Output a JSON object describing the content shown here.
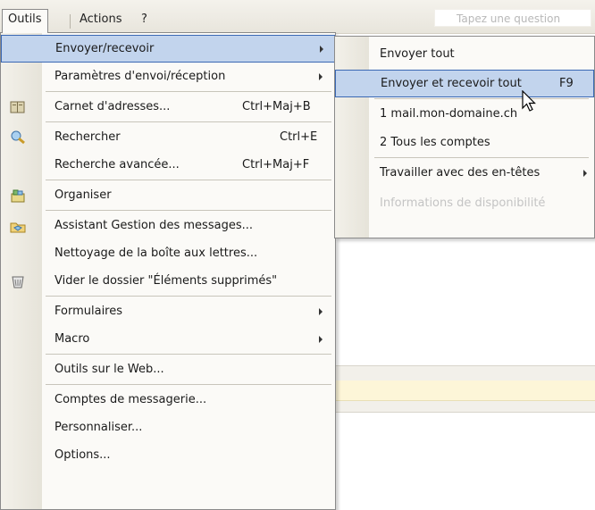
{
  "menubar": {
    "items": [
      {
        "label": "Outils"
      },
      {
        "label": "Actions"
      },
      {
        "label": "?"
      }
    ],
    "ask_placeholder": "Tapez une question"
  },
  "tools_menu": {
    "items": [
      {
        "label": "Envoyer/recevoir",
        "submenu": true
      },
      {
        "label": "Paramètres d'envoi/réception",
        "submenu": true
      },
      {
        "label": "Carnet d'adresses...",
        "shortcut": "Ctrl+Maj+B",
        "icon": "address-book-icon"
      },
      {
        "label": "Rechercher",
        "shortcut": "Ctrl+E",
        "icon": "search-icon"
      },
      {
        "label": "Recherche avancée...",
        "shortcut": "Ctrl+Maj+F"
      },
      {
        "label": "Organiser",
        "icon": "organize-icon"
      },
      {
        "label": "Assistant Gestion des messages...",
        "icon": "rules-wizard-icon"
      },
      {
        "label": "Nettoyage de la boîte aux lettres..."
      },
      {
        "label": "Vider le dossier \"Éléments supprimés\"",
        "icon": "empty-deleted-icon"
      },
      {
        "label": "Formulaires",
        "submenu": true
      },
      {
        "label": "Macro",
        "submenu": true
      },
      {
        "label": "Outils sur le Web..."
      },
      {
        "label": "Comptes de messagerie..."
      },
      {
        "label": "Personnaliser..."
      },
      {
        "label": "Options..."
      }
    ]
  },
  "send_receive_submenu": {
    "items": [
      {
        "label": "Envoyer tout"
      },
      {
        "label": "Envoyer et recevoir tout",
        "shortcut": "F9"
      },
      {
        "label": "1 mail.mon-domaine.ch"
      },
      {
        "label": "2 Tous les comptes"
      },
      {
        "label": "Travailler avec des en-têtes",
        "submenu": true
      },
      {
        "label": "Informations de disponibilité",
        "disabled": true
      }
    ]
  },
  "colors": {
    "highlight_fill": "#c2d4ed",
    "highlight_border": "#3a68b4",
    "menu_background": "#fbfaf7",
    "gutter": "#e6e3d9",
    "disabled_text": "#c4c4c4"
  }
}
